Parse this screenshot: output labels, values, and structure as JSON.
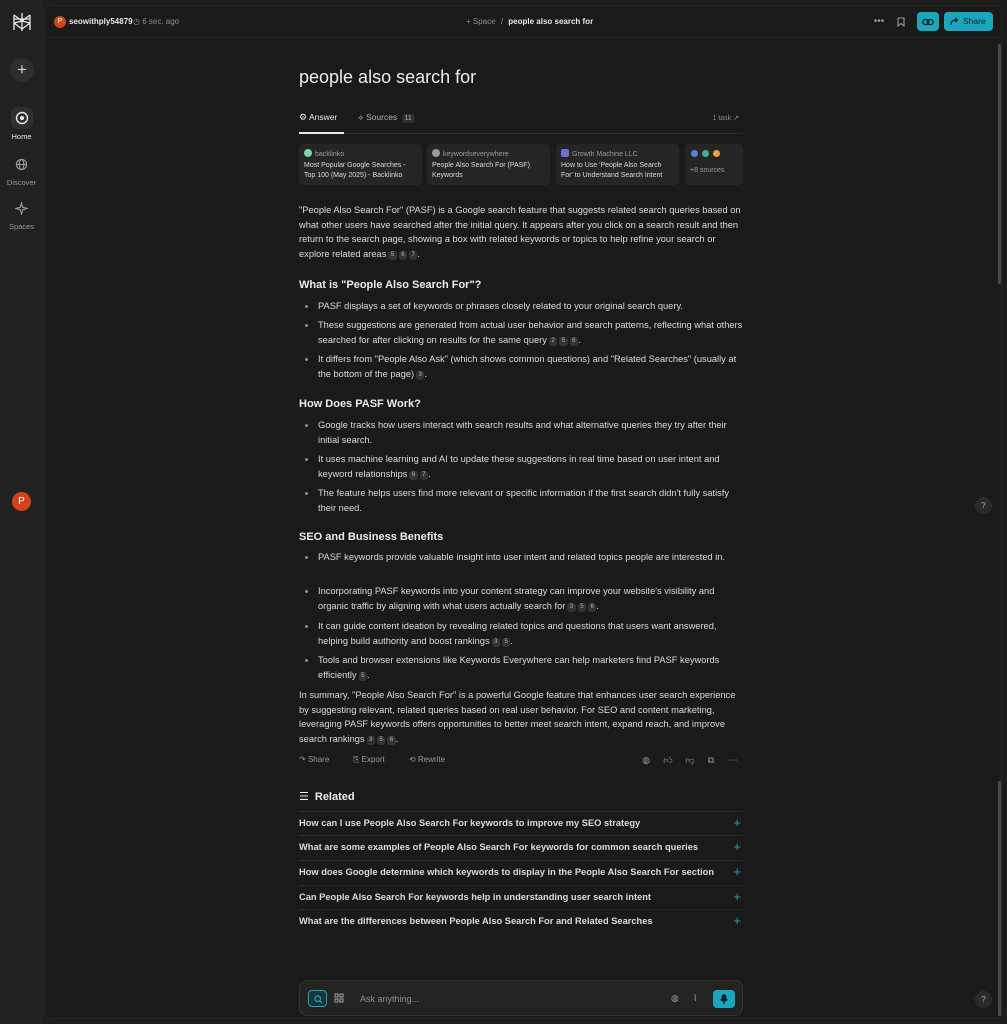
{
  "sidebar": {
    "items": [
      {
        "label": "Home"
      },
      {
        "label": "Discover"
      },
      {
        "label": "Spaces"
      }
    ],
    "avatar_letter": "P"
  },
  "topbar": {
    "user_letter": "P",
    "username": "seowithply54879",
    "time": "6 sec. ago",
    "space": "+ Space",
    "sep": "/",
    "page": "people also search for",
    "share_label": "Share"
  },
  "thread": {
    "title": "people also search for",
    "tabs": {
      "answer": "Answer",
      "sources": "Sources",
      "sources_count": "11",
      "task": "1 task ↗"
    },
    "sources": [
      {
        "site": "backlinko",
        "title": "Most Popular Google Searches - Top 100 (May 2025) - Backlinko",
        "color": "#7bd3a6"
      },
      {
        "site": "keywordseverywhere",
        "title": "People Also Search For (PASF) Keywords",
        "color": "#9a9b97"
      },
      {
        "site": "Growth Machine LLC",
        "title": "How to Use 'People Also Search For' to Understand Search Intent",
        "color": "#6b6fd6"
      }
    ],
    "more_sources": "+8 sources",
    "intro": "\"People Also Search For\" (PASF) is a Google search feature that suggests related search queries based on what other users have searched after the initial query. It appears after you click on a search result and then return to the search page, showing a box with related keywords or topics to help refine your search or explore related areas",
    "intro_cites": [
      "5",
      "6",
      "7"
    ],
    "sections": [
      {
        "heading": "What is \"People Also Search For\"?",
        "bullets": [
          {
            "text": "PASF displays a set of keywords or phrases closely related to your original search query.",
            "cites": []
          },
          {
            "text": "These suggestions are generated from actual user behavior and search patterns, reflecting what others searched for after clicking on results for the same query",
            "cites": [
              "2",
              "5",
              "6"
            ]
          },
          {
            "text": "It differs from \"People Also Ask\" (which shows common questions) and \"Related Searches\" (usually at the bottom of the page)",
            "cites": [
              "3"
            ]
          }
        ]
      },
      {
        "heading": "How Does PASF Work?",
        "bullets": [
          {
            "text": "Google tracks how users interact with search results and what alternative queries they try after their initial search.",
            "cites": []
          },
          {
            "text": "It uses machine learning and AI to update these suggestions in real time based on user intent and keyword relationships",
            "cites": [
              "6",
              "7"
            ]
          },
          {
            "text": "The feature helps users find more relevant or specific information if the first search didn't fully satisfy their need.",
            "cites": []
          }
        ]
      },
      {
        "heading": "SEO and Business Benefits",
        "bullets": [
          {
            "text": "PASF keywords provide valuable insight into user intent and related topics people are interested in.",
            "cites": []
          },
          {
            "text": "Incorporating PASF keywords into your content strategy can improve your website's visibility and organic traffic by aligning with what users actually search for",
            "cites": [
              "3",
              "5",
              "6"
            ]
          },
          {
            "text": "It can guide content ideation by revealing related topics and questions that users want answered, helping build authority and boost rankings",
            "cites": [
              "3",
              "5"
            ]
          },
          {
            "text": "Tools and browser extensions like Keywords Everywhere can help marketers find PASF keywords efficiently",
            "cites": [
              "5"
            ]
          }
        ]
      }
    ],
    "summary": "In summary, \"People Also Search For\" is a powerful Google feature that enhances user search experience by suggesting relevant, related queries based on real user behavior. For SEO and content marketing, leveraging PASF keywords offers opportunities to better meet search intent, expand reach, and improve search rankings",
    "summary_cites": [
      "3",
      "5",
      "6"
    ],
    "actions": {
      "share": "Share",
      "export": "Export",
      "rewrite": "Rewrite"
    },
    "related_heading": "Related",
    "related": [
      "How can I use People Also Search For keywords to improve my SEO strategy",
      "What are some examples of People Also Search For keywords for common search queries",
      "How does Google determine which keywords to display in the People Also Search For section",
      "Can People Also Search For keywords help in understanding user search intent",
      "What are the differences between People Also Search For and Related Searches"
    ]
  },
  "ask": {
    "placeholder": "Ask anything..."
  },
  "help_label": "?",
  "colors": {
    "accent": "#1aa7bd",
    "avatar": "#d2431c"
  }
}
